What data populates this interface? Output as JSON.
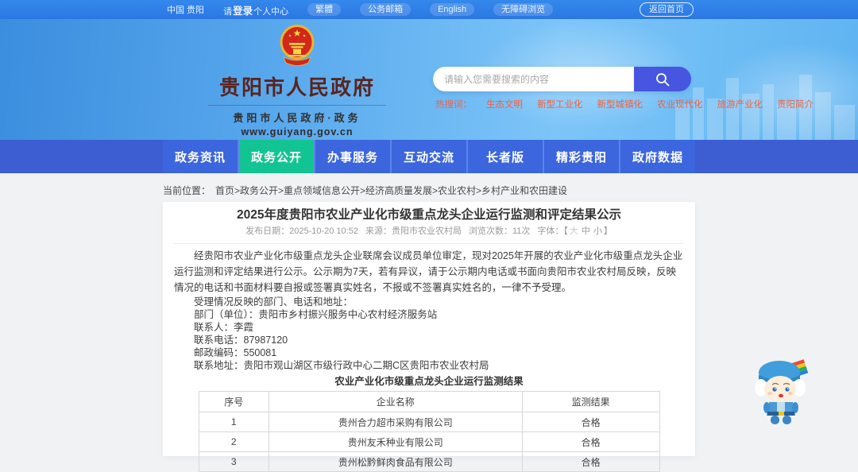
{
  "topbar": {
    "region": "中国 贵阳",
    "login_prefix": "请",
    "login_bold": "登录",
    "login_suffix": "个人中心",
    "traditional": "繁體",
    "mail": "公务邮箱",
    "english": "English",
    "accessibility": "无障碍浏览",
    "back_home": "返回首页"
  },
  "header": {
    "site_title": "贵阳市人民政府",
    "site_subtitle": "贵阳市人民政府·政务",
    "site_url": "www.guiyang.gov.cn",
    "search_placeholder": "请输入您需要搜索的内容",
    "hot_label": "热搜词：",
    "hot_words": [
      "生态文明",
      "新型工业化",
      "新型城镇化",
      "农业现代化",
      "旅游产业化",
      "贵阳简介"
    ]
  },
  "nav": {
    "items": [
      {
        "label": "政务资讯",
        "active": false
      },
      {
        "label": "政务公开",
        "active": true
      },
      {
        "label": "办事服务",
        "active": false
      },
      {
        "label": "互动交流",
        "active": false
      },
      {
        "label": "长者版",
        "active": false
      },
      {
        "label": "精彩贵阳",
        "active": false
      },
      {
        "label": "政府数据",
        "active": false
      }
    ]
  },
  "breadcrumb": {
    "label": "当前位置：",
    "path": "首页>政务公开>重点领域信息公开>经济高质量发展>农业农村>乡村产业和农田建设"
  },
  "article": {
    "title": "2025年度贵阳市农业产业化市级重点龙头企业运行监测和评定结果公示",
    "meta": {
      "publish_label": "发布日期：",
      "publish_value": "2025-10-20 10:52",
      "source_label": "来源：",
      "source_value": "贵阳市农业农村局",
      "views_label": "浏览次数：",
      "views_value": "11次",
      "font_label": "字体：",
      "font_open": "【",
      "font_sizes": [
        "大",
        "中",
        "小"
      ],
      "font_close": "】"
    },
    "paragraphs": [
      "经贵阳市农业产业化市级重点龙头企业联席会议成员单位审定，现对2025年开展的农业产业化市级重点龙头企业运行监测和评定结果进行公示。公示期为7天，若有异议，请于公示期内电话或书面向贵阳市农业农村局反映，反映情况的电话和书面材料要自报或签署真实姓名，不报或不签署真实姓名的，一律不予受理。",
      "受理情况反映的部门、电话和地址：",
      "部门（单位）：贵阳市乡村振兴服务中心农村经济服务站",
      "联系人：李霞",
      "联系电话：87987120",
      "邮政编码：550081",
      "联系地址：贵阳市观山湖区市级行政中心二期C区贵阳市农业农村局"
    ],
    "table": {
      "title": "农业产业化市级重点龙头企业运行监测结果",
      "headers": [
        "序号",
        "企业名称",
        "监测结果"
      ],
      "rows": [
        [
          "1",
          "贵州合力超市采购有限公司",
          "合格"
        ],
        [
          "2",
          "贵州友禾种业有限公司",
          "合格"
        ],
        [
          "3",
          "贵州松黔鲜肉食品有限公司",
          "合格"
        ]
      ]
    }
  },
  "colors": {
    "topbar_blue": "#2b77e2",
    "banner_blue": "#56a6ec",
    "nav_blue": "#3c66dd",
    "nav_active_green": "#13c493",
    "search_button_blue": "#4656e0",
    "hot_word_orange": "#f4603e",
    "site_title_maroon": "#5a241c",
    "emblem_red": "#d3271b",
    "emblem_gold": "#e9b432",
    "table_border": "#d8d8d8"
  }
}
